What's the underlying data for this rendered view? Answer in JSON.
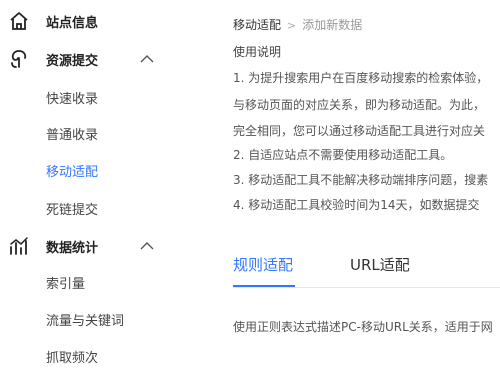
{
  "sidebar": {
    "site_info": {
      "label": "站点信息",
      "icon": "home-icon"
    },
    "resource_submit": {
      "label": "资源提交",
      "icon": "resource-submit-icon",
      "items": [
        {
          "label": "快速收录"
        },
        {
          "label": "普通收录"
        },
        {
          "label": "移动适配",
          "active": true
        },
        {
          "label": "死链提交"
        }
      ]
    },
    "data_stats": {
      "label": "数据统计",
      "icon": "stats-icon",
      "items": [
        {
          "label": "索引量"
        },
        {
          "label": "流量与关键词"
        },
        {
          "label": "抓取频次"
        }
      ]
    }
  },
  "breadcrumb": {
    "parent": "移动适配",
    "separator": ">",
    "current": "添加新数据"
  },
  "usage": {
    "title": "使用说明",
    "lines": [
      "1. 为提升搜索用户在百度移动搜索的检索体验，",
      "与移动页面的对应关系，即为移动适配。为此，",
      "完全相同，您可以通过移动适配工具进行对应关",
      "2. 自适应站点不需要使用移动适配工具。",
      "3. 移动适配工具不能解决移动端排序问题，搜素",
      "4. 移动适配工具校验时间为14天，如数据提交"
    ]
  },
  "tabs": [
    {
      "label": "规则适配",
      "active": true
    },
    {
      "label": "URL适配",
      "active": false
    }
  ],
  "rule_description": "使用正则表达式描述PC-移动URL关系，适用于网",
  "colors": {
    "accent": "#3377ff",
    "text": "#333333",
    "muted": "#999999"
  }
}
